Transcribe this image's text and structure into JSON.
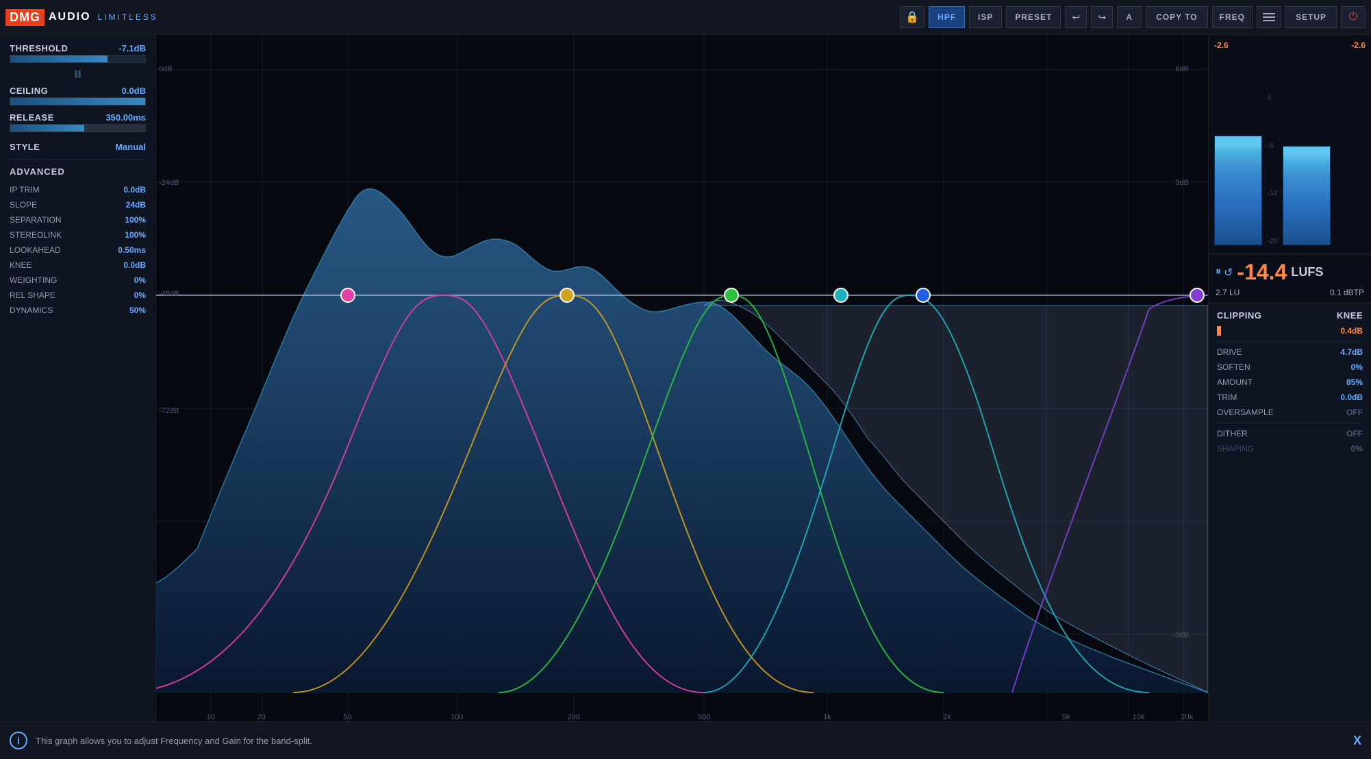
{
  "app": {
    "brand_dmg": "DMG",
    "brand_audio": "AUDIO",
    "brand_product": "LIMITLESS"
  },
  "topbar": {
    "lock_icon": "🔒",
    "hpf_label": "HPF",
    "isp_label": "ISP",
    "preset_label": "PRESET",
    "undo_icon": "↩",
    "redo_icon": "↪",
    "a_label": "A",
    "copy_to_label": "COPY TO",
    "freq_label": "FREQ",
    "setup_label": "SETUP",
    "power_icon": "⏻"
  },
  "left": {
    "threshold_label": "THRESHOLD",
    "threshold_value": "-7.1dB",
    "ceiling_label": "CEILING",
    "ceiling_value": "0.0dB",
    "release_label": "RELEASE",
    "release_value": "350.00ms",
    "style_label": "STYLE",
    "style_value": "Manual",
    "advanced_label": "ADVANCED",
    "ip_trim_label": "IP TRIM",
    "ip_trim_value": "0.0dB",
    "slope_label": "SLOPE",
    "slope_value": "24dB",
    "separation_label": "SEPARATION",
    "separation_value": "100%",
    "stereolink_label": "STEREOLINK",
    "stereolink_value": "100%",
    "lookahead_label": "LOOKAHEAD",
    "lookahead_value": "0.50ms",
    "knee_label": "KNEE",
    "knee_value": "0.0dB",
    "weighting_label": "WEIGHTING",
    "weighting_value": "0%",
    "rel_shape_label": "REL SHAPE",
    "rel_shape_value": "0%",
    "dynamics_label": "DYNAMICS",
    "dynamics_value": "50%"
  },
  "right": {
    "meter_left_label": "-2.6",
    "meter_right_label": "-2.6",
    "loudness_value": "-14.4",
    "loudness_unit": "LUFS",
    "lu_label": "2.7 LU",
    "dbtp_label": "0.1 dBTP",
    "clipping_label": "CLIPPING",
    "knee_label": "KNEE",
    "clipping_value": "0.4dB",
    "drive_label": "DRIVE",
    "drive_value": "4.7dB",
    "soften_label": "SOFTEN",
    "soften_value": "0%",
    "amount_label": "AMOUNT",
    "amount_value": "85%",
    "trim_label": "TRIM",
    "trim_value": "0.0dB",
    "oversample_label": "OVERSAMPLE",
    "oversample_value": "OFF",
    "dither_label": "DITHER",
    "dither_value": "OFF",
    "shaping_label": "SHAPING",
    "shaping_value": "0%"
  },
  "spectrum": {
    "db_labels": [
      "0dB",
      "-24dB",
      "-48dB",
      "-72dB"
    ],
    "db_right_labels": [
      "6dB",
      "3dB",
      "-3dB"
    ],
    "freq_labels": [
      "10",
      "20",
      "50",
      "100",
      "200",
      "500",
      "1k",
      "2k",
      "5k",
      "10k",
      "20k"
    ]
  },
  "bottom": {
    "info_text": "This graph allows you to adjust Frequency and Gain for the band-split.",
    "close_label": "X"
  }
}
